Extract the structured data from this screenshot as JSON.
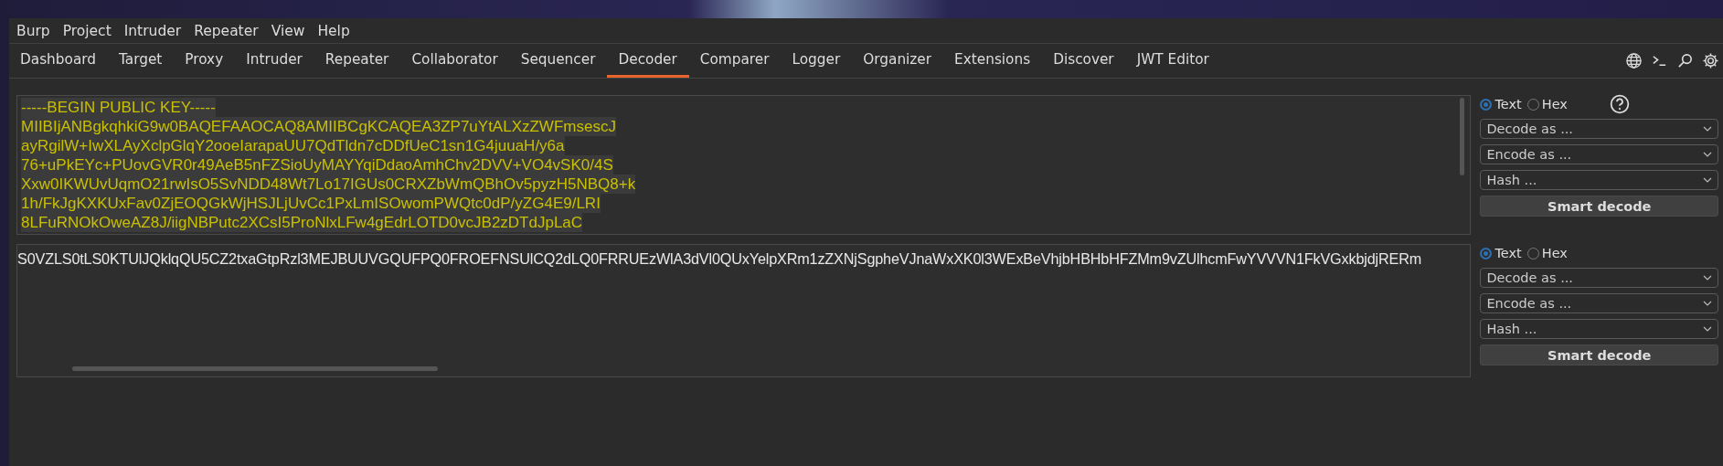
{
  "menu": [
    "Burp",
    "Project",
    "Intruder",
    "Repeater",
    "View",
    "Help"
  ],
  "tabs": [
    {
      "label": "Dashboard",
      "selected": false
    },
    {
      "label": "Target",
      "selected": false
    },
    {
      "label": "Proxy",
      "selected": false
    },
    {
      "label": "Intruder",
      "selected": false
    },
    {
      "label": "Repeater",
      "selected": false
    },
    {
      "label": "Collaborator",
      "selected": false
    },
    {
      "label": "Sequencer",
      "selected": false
    },
    {
      "label": "Decoder",
      "selected": true
    },
    {
      "label": "Comparer",
      "selected": false
    },
    {
      "label": "Logger",
      "selected": false
    },
    {
      "label": "Organizer",
      "selected": false
    },
    {
      "label": "Extensions",
      "selected": false
    },
    {
      "label": "Discover",
      "selected": false
    },
    {
      "label": "JWT Editor",
      "selected": false
    }
  ],
  "panels": [
    {
      "text_selected": true,
      "lines": [
        "-----BEGIN PUBLIC KEY-----",
        "MIIBIjANBgkqhkiG9w0BAQEFAAOCAQ8AMIIBCgKCAQEA3ZP7uYtALXzZWFmsescJ",
        "ayRgilW+IwXLAyXclpGlqY2ooeIarapaUU7QdTldn7cDDfUeC1sn1G4juuaH/y6a",
        "76+uPkEYc+PUovGVR0r49AeB5nFZSioUyMAYYqiDdaoAmhChv2DVV+VO4vSK0/4S",
        "Xxw0IKWUvUqmO21rwIsO5SvNDD48Wt7Lo17IGUs0CRXZbWmQBhOv5pyzH5NBQ8+k",
        "1h/FkJgKXKUxFav0ZjEOQGkWjHSJLjUvCc1PxLmISOwomPWQtc0dP/yZG4E9/LRI",
        "8LFuRNOkOweAZ8J/iigNBPutc2XCsI5ProNlxLFw4gEdrLOTD0vcJB2zDTdJpLaC"
      ],
      "modes": [
        {
          "label": "Text",
          "selected": true
        },
        {
          "label": "Hex",
          "selected": false
        }
      ],
      "dropdowns": [
        "Decode as ...",
        "Encode as ...",
        "Hash ..."
      ],
      "button": "Smart decode"
    },
    {
      "text_selected": false,
      "lines": [
        "S0VZLS0tLS0KTUlJQklqQU5CZ2txaGtpRzl3MEJBUUVGQUFPQ0FROEFNSUlCQ2dLQ0FRRUEzWlA3dVl0QUxYelpXRm1zZXNjSgpheVJnaWxXK0l3WExBeVhjbHBHbHFZMm9vZUlhcmFwYVVVN1FkVGxkbjdjRERm"
      ],
      "modes": [
        {
          "label": "Text",
          "selected": true
        },
        {
          "label": "Hex",
          "selected": false
        }
      ],
      "dropdowns": [
        "Decode as ...",
        "Encode as ...",
        "Hash ..."
      ],
      "button": "Smart decode"
    }
  ]
}
